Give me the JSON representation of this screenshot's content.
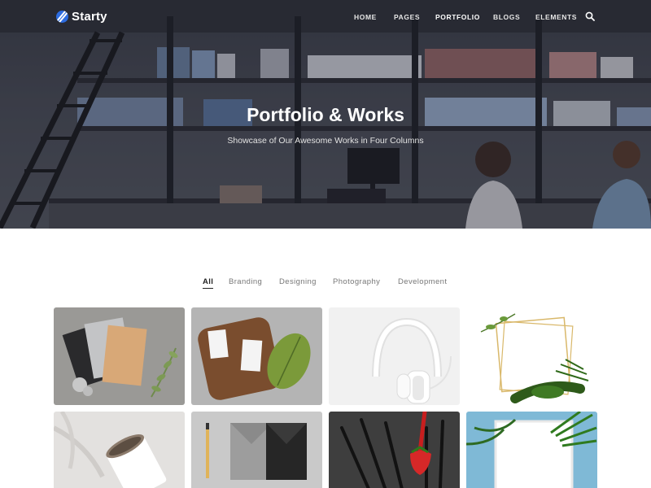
{
  "brand": {
    "name": "Starty"
  },
  "nav": {
    "items": [
      {
        "label": "HOME",
        "active": false
      },
      {
        "label": "PAGES",
        "active": false
      },
      {
        "label": "PORTFOLIO",
        "active": true
      },
      {
        "label": "BLOGS",
        "active": false
      },
      {
        "label": "ELEMENTS",
        "active": false
      }
    ],
    "search_icon": "search-icon"
  },
  "hero": {
    "title": "Portfolio & Works",
    "subtitle": "Showcase of Our Awesome Works in Four Columns"
  },
  "filters": {
    "items": [
      {
        "label": "All",
        "active": true
      },
      {
        "label": "Branding",
        "active": false
      },
      {
        "label": "Designing",
        "active": false
      },
      {
        "label": "Photography",
        "active": false
      },
      {
        "label": "Development",
        "active": false
      }
    ]
  },
  "portfolio": {
    "items": [
      {
        "subject": "stationery-cards-mockup"
      },
      {
        "subject": "business-cards-wood-board"
      },
      {
        "subject": "white-headphones"
      },
      {
        "subject": "gold-frame-leaves"
      },
      {
        "subject": "paper-coffee-cup"
      },
      {
        "subject": "envelopes-and-pen"
      },
      {
        "subject": "black-forks-strawberry"
      },
      {
        "subject": "white-frame-palm-leaves"
      }
    ]
  },
  "colors": {
    "accent": "#2d6cdf",
    "hero_overlay": "#1c1e28",
    "active_text": "#222222",
    "muted_text": "#777777"
  }
}
